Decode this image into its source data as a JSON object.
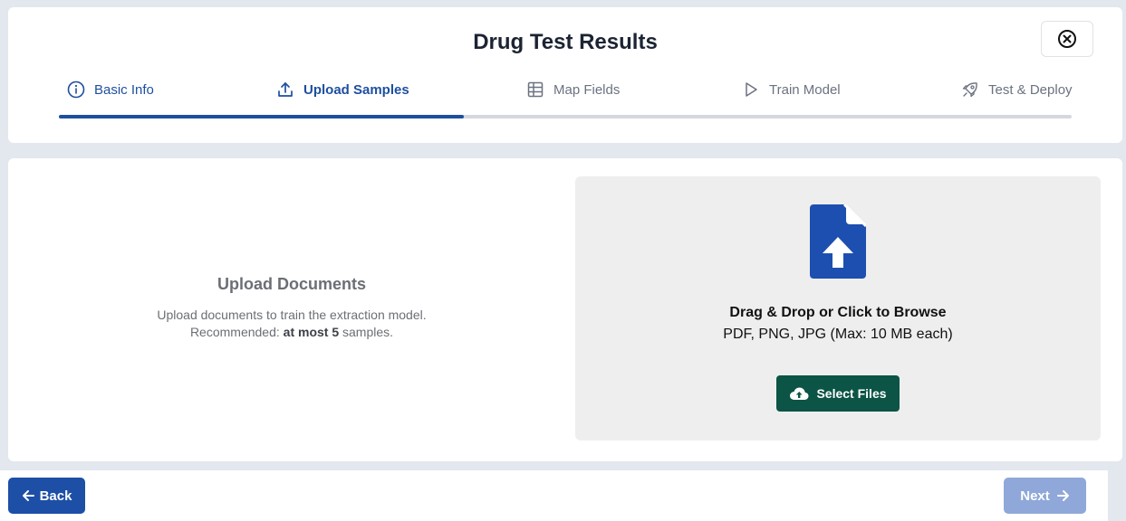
{
  "header": {
    "title": "Drug Test Results",
    "close_icon": "close-circle-icon"
  },
  "steps": [
    {
      "label": "Basic Info",
      "icon": "info-icon",
      "state": "done"
    },
    {
      "label": "Upload Samples",
      "icon": "upload-icon",
      "state": "active"
    },
    {
      "label": "Map Fields",
      "icon": "table-icon",
      "state": "pending"
    },
    {
      "label": "Train Model",
      "icon": "play-icon",
      "state": "pending"
    },
    {
      "label": "Test & Deploy",
      "icon": "rocket-icon",
      "state": "pending"
    }
  ],
  "progress": {
    "completed_fraction": 0.4
  },
  "upload_info": {
    "title": "Upload Documents",
    "line1": "Upload documents to train the extraction model.",
    "line2_prefix": "Recommended: ",
    "line2_bold": "at most 5",
    "line2_suffix": " samples."
  },
  "dropzone": {
    "icon": "file-upload-icon",
    "title": "Drag & Drop or Click to Browse",
    "subtitle": "PDF, PNG, JPG (Max: 10 MB each)",
    "button_label": "Select Files",
    "button_icon": "cloud-upload-icon"
  },
  "footer": {
    "back_label": "Back",
    "next_label": "Next"
  },
  "colors": {
    "primary": "#1d4f9f",
    "select_button": "#0b5446",
    "next_disabled": "#8fa8d9",
    "dropzone_bg": "#eeeeee"
  }
}
